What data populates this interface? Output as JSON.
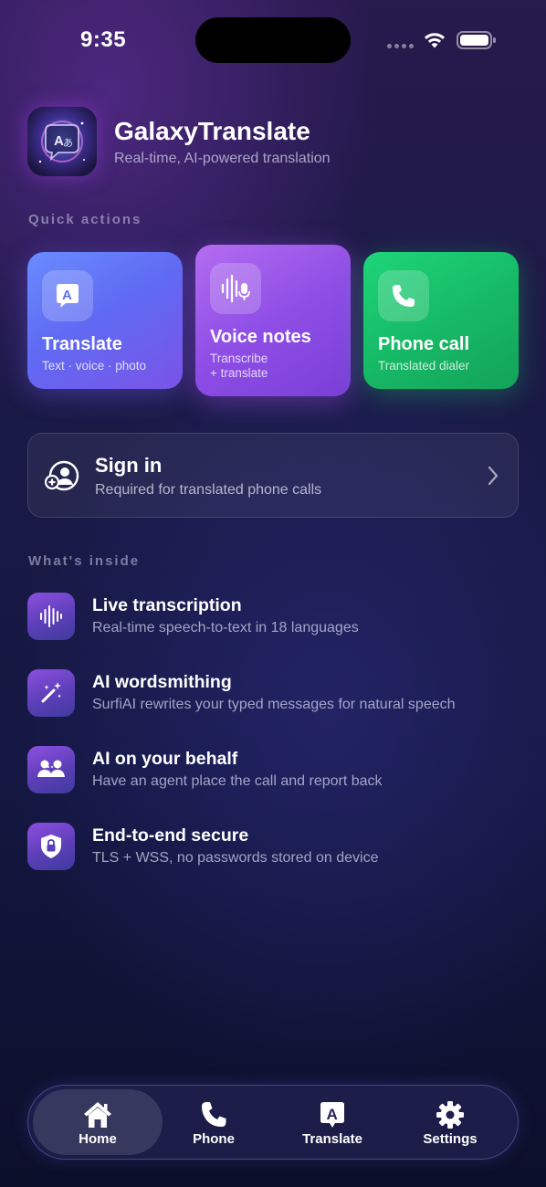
{
  "status_bar": {
    "time": "9:35"
  },
  "app": {
    "name": "GalaxyTranslate",
    "tagline": "Real-time, AI-powered translation"
  },
  "quick_actions": {
    "section_label": "Quick actions",
    "items": [
      {
        "title": "Translate",
        "subtitle": "Text · voice · photo",
        "icon": "translate-icon"
      },
      {
        "title": "Voice notes",
        "subtitle_line1": "Transcribe",
        "subtitle_line2": "+ translate",
        "icon": "voice-notes-icon"
      },
      {
        "title": "Phone call",
        "subtitle": "Translated dialer",
        "icon": "phone-icon"
      }
    ]
  },
  "sign_in": {
    "title": "Sign in",
    "subtitle": "Required for translated phone calls"
  },
  "features": {
    "section_label": "What's inside",
    "items": [
      {
        "title": "Live transcription",
        "subtitle": "Real-time speech-to-text in 18 languages",
        "icon": "waveform-icon"
      },
      {
        "title": "AI wordsmithing",
        "subtitle": "SurfiAI rewrites your typed messages for natural speech",
        "icon": "magic-wand-icon"
      },
      {
        "title": "AI on your behalf",
        "subtitle": "Have an agent place the call and report back",
        "icon": "people-icon"
      },
      {
        "title": "End-to-end secure",
        "subtitle": "TLS + WSS, no passwords stored on device",
        "icon": "lock-shield-icon"
      }
    ]
  },
  "tabbar": {
    "selected": "Home",
    "items": [
      {
        "label": "Home",
        "icon": "house-icon"
      },
      {
        "label": "Phone",
        "icon": "phone-icon"
      },
      {
        "label": "Translate",
        "icon": "translate-icon"
      },
      {
        "label": "Settings",
        "icon": "gear-icon"
      }
    ]
  },
  "colors": {
    "translate_card": "#6275f5",
    "voice_card": "#9a55ea",
    "phone_card": "#18c26a",
    "background": "#1a1a46"
  }
}
